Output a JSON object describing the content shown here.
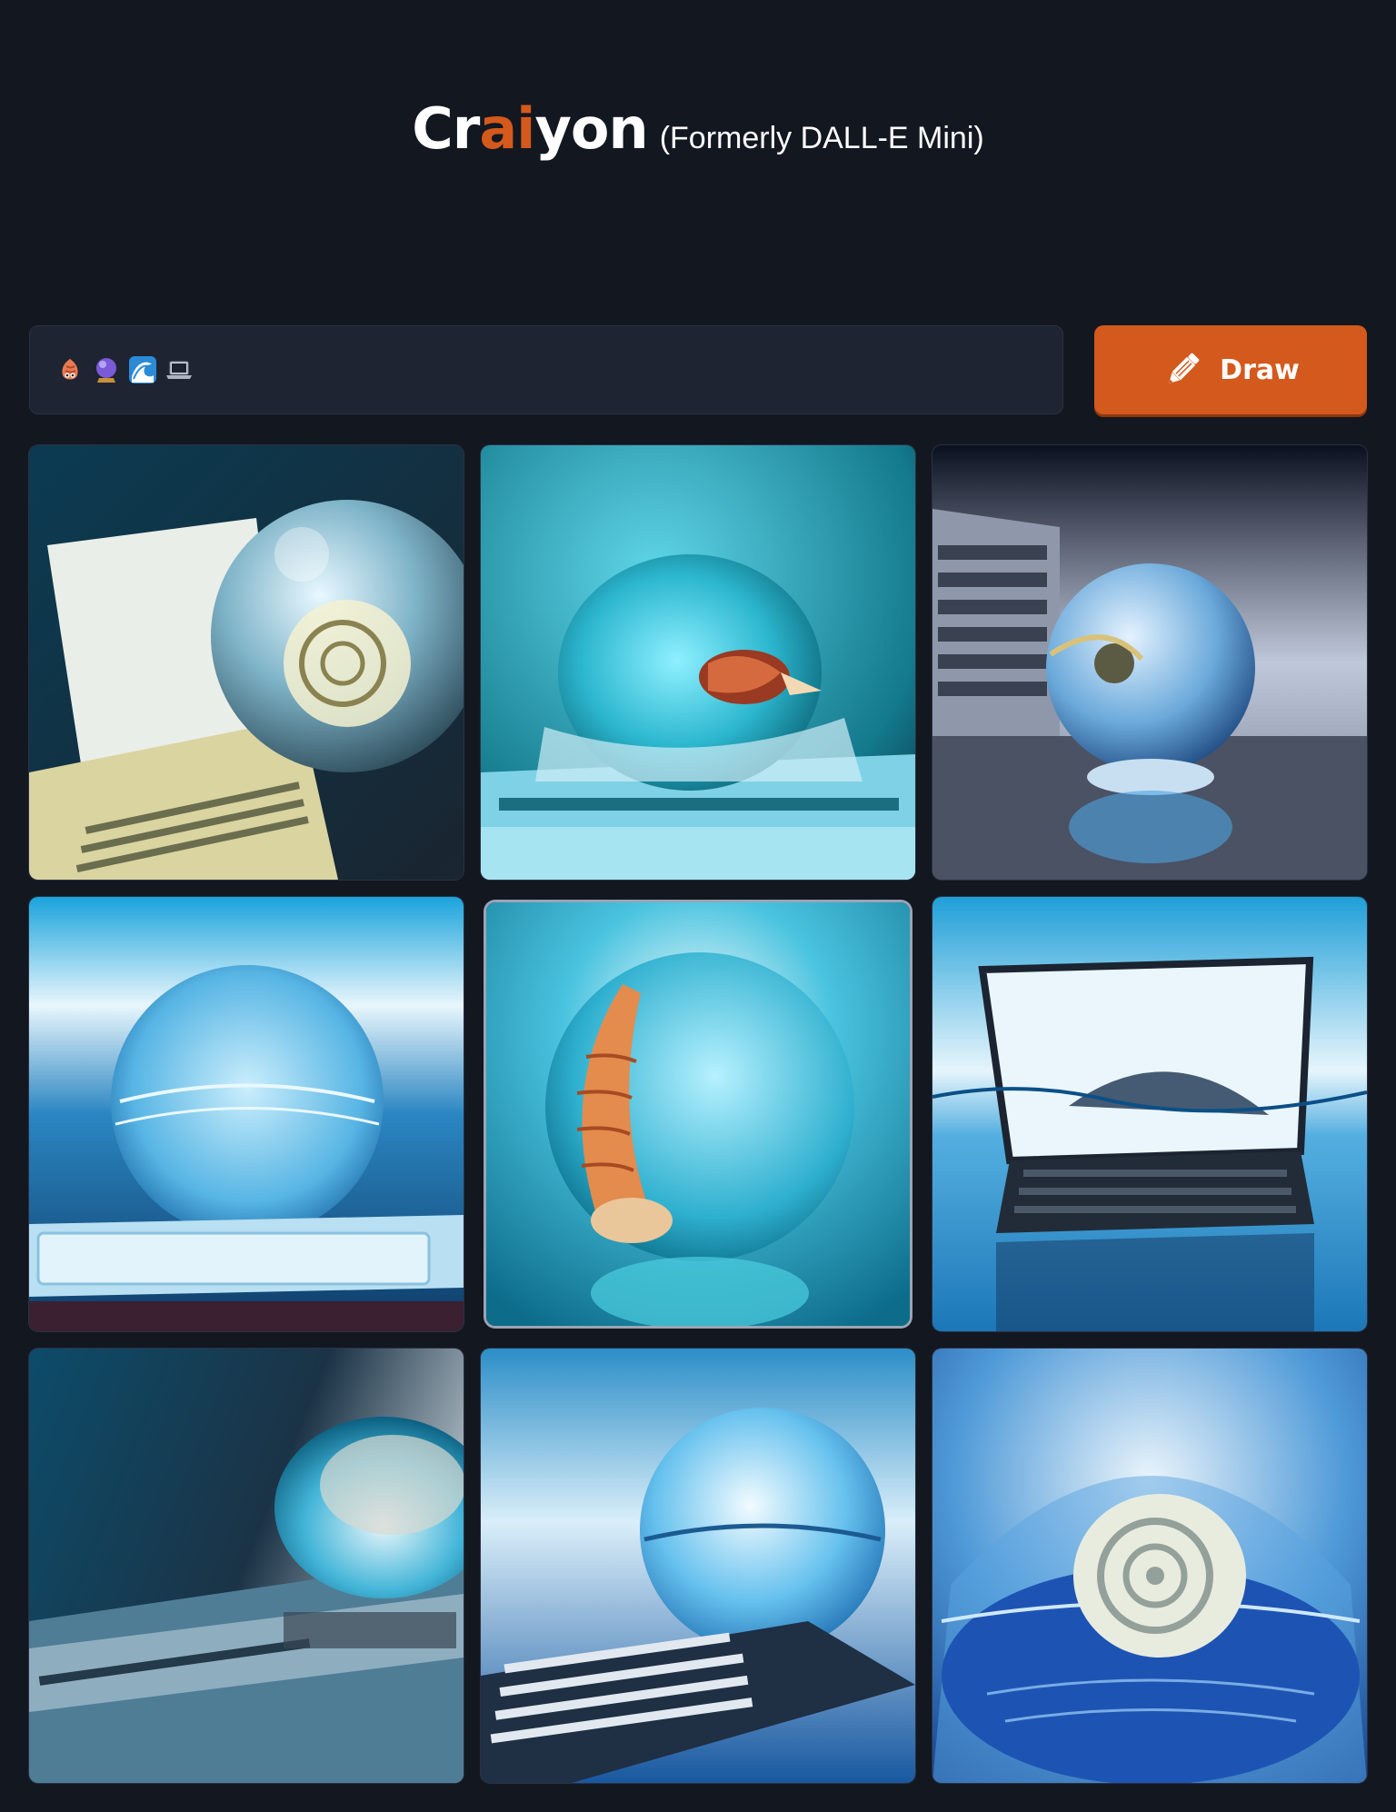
{
  "header": {
    "brand_prefix": "Cr",
    "brand_accent": "ai",
    "brand_suffix": "yon",
    "subtitle": "(Formerly DALL-E Mini)"
  },
  "prompt": {
    "emoji_icons": [
      "hermit-crab-emoji",
      "crystal-ball-emoji",
      "water-wave-emoji",
      "laptop-emoji"
    ]
  },
  "draw_button": {
    "label": "Draw",
    "icon": "pencil-icon"
  },
  "results": {
    "images": [
      {
        "subject": "laptop-with-glass-snail-shell"
      },
      {
        "subject": "glass-sphere-with-hermit-crab-on-laptop"
      },
      {
        "subject": "crystal-ball-beside-keyboard"
      },
      {
        "subject": "water-sphere-on-laptop-trackpad"
      },
      {
        "subject": "crystal-ball-with-shell-on-water"
      },
      {
        "subject": "laptop-in-water"
      },
      {
        "subject": "glass-dome-on-laptop"
      },
      {
        "subject": "crystal-ball-on-laptop-keyboard"
      },
      {
        "subject": "spiral-shell-in-water-bubble"
      }
    ]
  },
  "colors": {
    "background": "#131720",
    "accent": "#d4591c",
    "input_background": "#1f2433"
  }
}
